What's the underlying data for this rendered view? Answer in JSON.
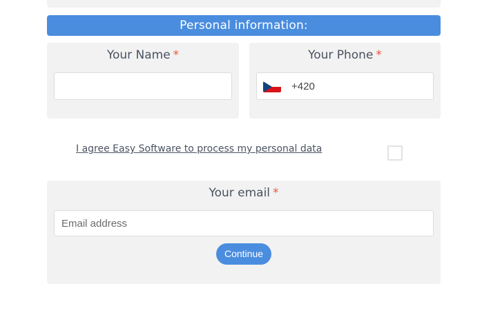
{
  "section": {
    "title": "Personal information:"
  },
  "name_field": {
    "label": "Your Name",
    "required_mark": "*",
    "value": ""
  },
  "phone_field": {
    "label": "Your Phone",
    "required_mark": "*",
    "country_flag": "czech-republic-flag-icon",
    "value": "+420"
  },
  "consent": {
    "text": "I agree Easy Software to process my personal data",
    "checked": false
  },
  "email_field": {
    "label": "Your email",
    "required_mark": "*",
    "placeholder": "Email address",
    "value": ""
  },
  "continue_button": {
    "label": "Continue"
  },
  "colors": {
    "accent": "#4a8ddf",
    "required": "#e8573c",
    "card_background": "#f2f2f2",
    "text": "#4a5260"
  }
}
